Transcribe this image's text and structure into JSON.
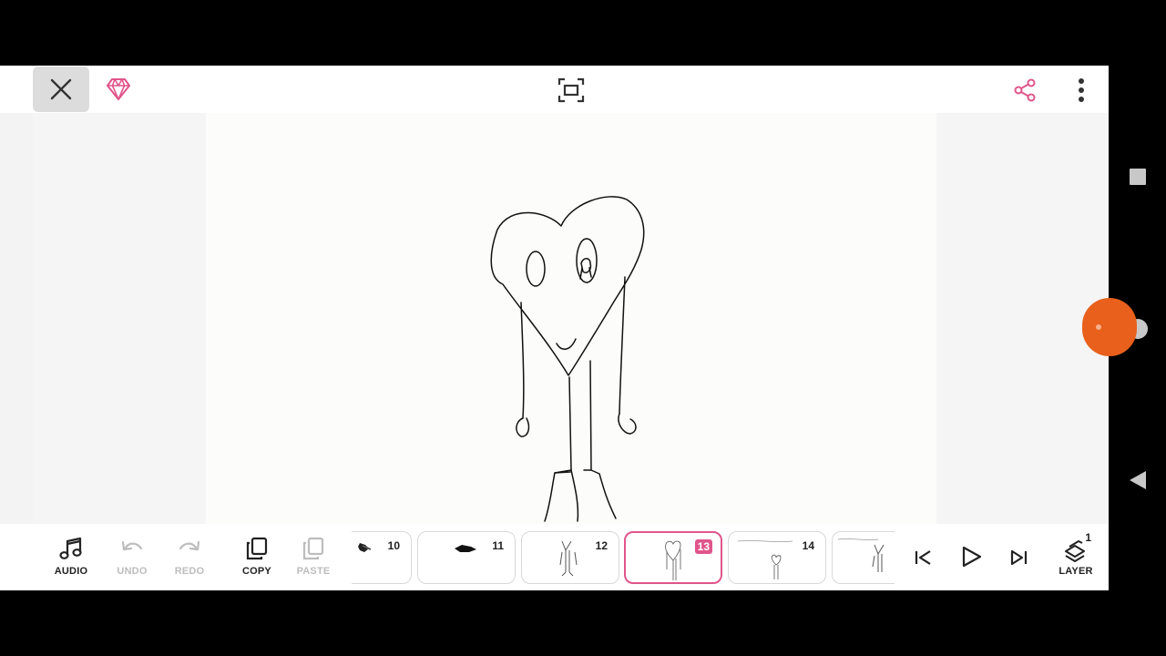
{
  "toolbar": {
    "audio_label": "AUDIO",
    "undo_label": "UNDO",
    "redo_label": "REDO",
    "copy_label": "COPY",
    "paste_label": "PASTE",
    "layer_label": "LAYER",
    "layer_count": "1"
  },
  "frames": [
    {
      "number": "10"
    },
    {
      "number": "11"
    },
    {
      "number": "12"
    },
    {
      "number": "13",
      "selected": true
    },
    {
      "number": "14"
    }
  ],
  "colors": {
    "accent": "#e0558b",
    "fab": "#e8601c",
    "close_bg": "#dcdcdc"
  }
}
